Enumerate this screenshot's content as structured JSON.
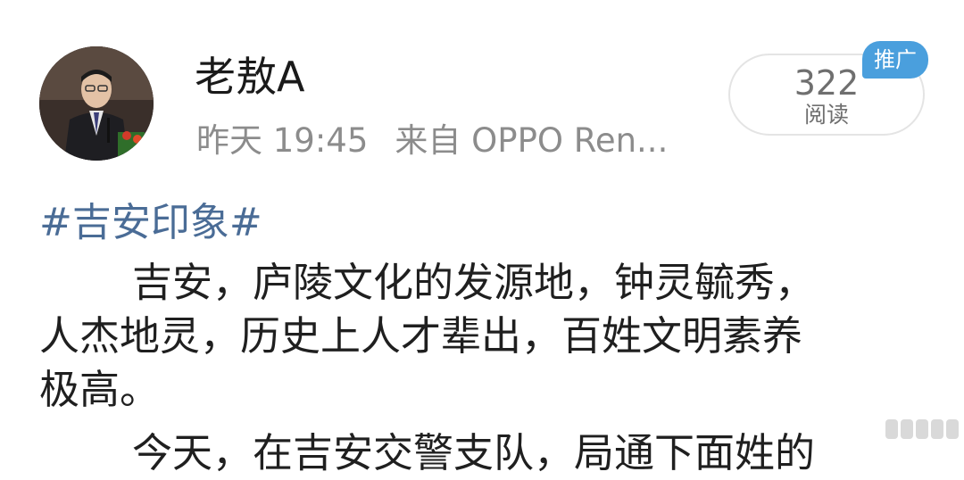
{
  "author": {
    "name": "老敖A",
    "avatar_icon": "portrait-avatar"
  },
  "post_meta": {
    "time": "昨天 19:45",
    "source": "来自 OPPO Ren..."
  },
  "stats": {
    "reads_count": "322",
    "reads_label": "阅读",
    "promo_badge": "推广"
  },
  "content": {
    "topic": "#吉安印象#",
    "lines": [
      "吉安，庐陵文化的发源地，钟灵毓秀，",
      "人杰地灵，历史上人才辈出，百姓文明素养",
      "极高。"
    ],
    "next_line_partial": "今天，在吉安交警支队，局通下面姓的"
  },
  "colors": {
    "topic_link": "#4a6c96",
    "badge": "#4a9fdd",
    "meta_text": "#8c8c8c"
  }
}
